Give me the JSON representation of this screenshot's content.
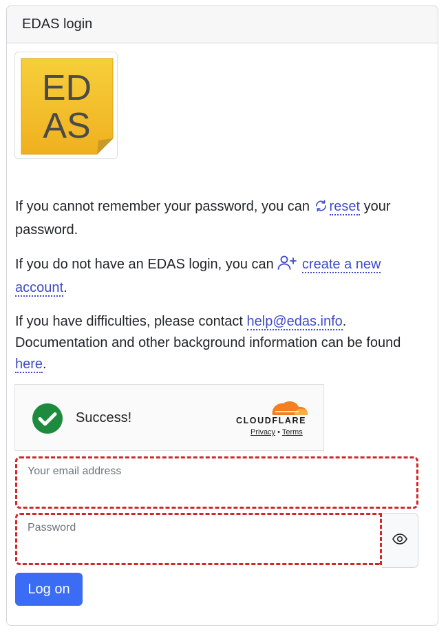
{
  "card": {
    "title": "EDAS login"
  },
  "logo": {
    "line1": "ED",
    "line2": "AS"
  },
  "reset_para": {
    "before": "If you cannot remember your password, you can ",
    "link": "reset",
    "after": " your password."
  },
  "account_para": {
    "before": "If you do not have an EDAS login, you can ",
    "link": "create a new account",
    "after": "."
  },
  "help_para": {
    "before": "If you have difficulties, please contact ",
    "email_link": "help@edas.info",
    "middle": ". Documentation and other background information can be found ",
    "here_link": "here",
    "after": "."
  },
  "captcha": {
    "status": "Success!",
    "brand": "CLOUDFLARE",
    "privacy": "Privacy",
    "separator": "•",
    "terms": "Terms"
  },
  "form": {
    "email_placeholder": "Your email address",
    "password_placeholder": "Password",
    "submit_label": "Log on"
  },
  "icons": {
    "reset": "refresh-icon",
    "account": "user-plus-icon",
    "captcha_status": "check-circle-icon",
    "password_toggle": "eye-icon"
  },
  "colors": {
    "link": "#3d4bc8",
    "primary_button": "#3b6cf6",
    "validation_border": "#d32626",
    "success_green": "#1e8a3e",
    "cloudflare_orange": "#f38020"
  }
}
